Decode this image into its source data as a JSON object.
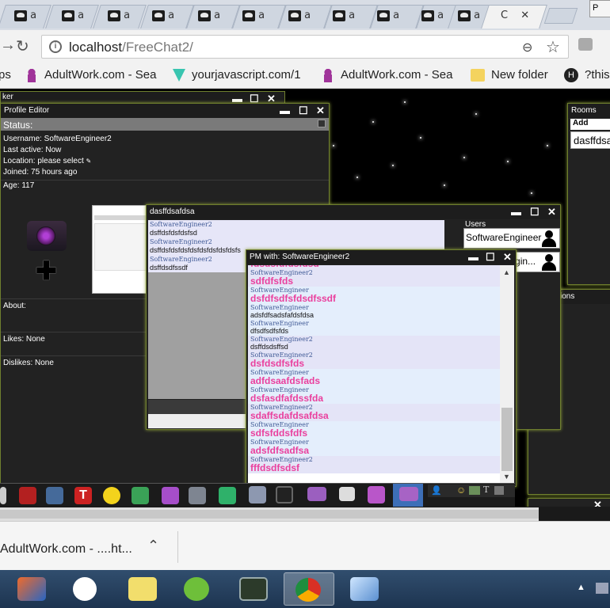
{
  "browser": {
    "tab_labels": [
      "a",
      "a",
      "a",
      "a",
      "a",
      "a",
      "a",
      "a",
      "a",
      "a",
      "a",
      "C"
    ],
    "window_corner_text": "P",
    "url_host": "localhost",
    "url_path": "/FreeChat2/",
    "bookmarks": [
      {
        "label": "ps"
      },
      {
        "label": "AdultWork.com - Sea"
      },
      {
        "label": "yourjavascript.com/1"
      },
      {
        "label": "AdultWork.com - Sea"
      },
      {
        "label": "New folder"
      },
      {
        "label": "?this"
      }
    ]
  },
  "profile_editor": {
    "behind_title": "ker",
    "title": "Profile Editor",
    "status_label": "Status:",
    "lines": [
      "Username: SoftwareEngineer2",
      "Last active: Now",
      "Location: please select",
      "Joined: 75 hours ago",
      "Age: 117"
    ],
    "about": "About:",
    "likes": "Likes: None",
    "dislikes": "Dislikes: None"
  },
  "room_window": {
    "title": "dasffdsafdsa",
    "messages": [
      {
        "user": "SoftwareEngineer2",
        "text": "dsffdsfdsfdsfsd"
      },
      {
        "user": "SoftwareEngineer2",
        "text": "dsffdsfdsfdsfdsfdsfdsfdsfdsfs"
      },
      {
        "user": "SoftwareEngineer2",
        "text": "dsffdsdfssdf"
      }
    ],
    "users_label": "Users",
    "users": [
      "SoftwareEngineer",
      "SoftwareEngin..."
    ]
  },
  "pm_window": {
    "title": "PM with: SoftwareEngineer2",
    "messages": [
      {
        "user": "",
        "text": "fdsdsfdfdsfdsd",
        "style": "big"
      },
      {
        "user": "SoftwareEngineer2",
        "text": "sdfdfsfds",
        "style": "big"
      },
      {
        "user": "SoftwareEngineer",
        "text": "dsfdfsdfsfdsdfssdf",
        "style": "big"
      },
      {
        "user": "SoftwareEngineer",
        "text": "adsfdfsadsfafdsfdsa",
        "style": "small"
      },
      {
        "user": "SoftwareEngineer",
        "text": "dfsdfsdfsfds",
        "style": "small"
      },
      {
        "user": "SoftwareEngineer2",
        "text": "dsffdsdsffsd",
        "style": "small"
      },
      {
        "user": "SoftwareEngineer2",
        "text": "dsfdsdfsfds",
        "style": "big"
      },
      {
        "user": "SoftwareEngineer",
        "text": "adfdsaafdsfads",
        "style": "big"
      },
      {
        "user": "SoftwareEngineer",
        "text": "dsfasdfafdssfda",
        "style": "big"
      },
      {
        "user": "SoftwareEngineer2",
        "text": "sdaffsdafdsafdsa",
        "style": "big"
      },
      {
        "user": "SoftwareEngineer",
        "text": "sdfsfddsfdfs",
        "style": "big"
      },
      {
        "user": "SoftwareEngineer",
        "text": "adsfdfsadfsa",
        "style": "big"
      },
      {
        "user": "SoftwareEngineer2",
        "text": "fffdsdfsdsf",
        "style": "big"
      }
    ]
  },
  "rooms_panel": {
    "title": "Rooms",
    "add_label": "Add",
    "items": [
      "dasffdsa"
    ]
  },
  "side_panel": {
    "title": "ions"
  },
  "download_shelf": {
    "filename": "AdultWork.com - ....ht..."
  },
  "colors": {
    "window_border": "#6f7f2e",
    "pm_accent": "#ea3f9d",
    "username_blue": "#405a96",
    "taskbar": "#1d3450"
  }
}
